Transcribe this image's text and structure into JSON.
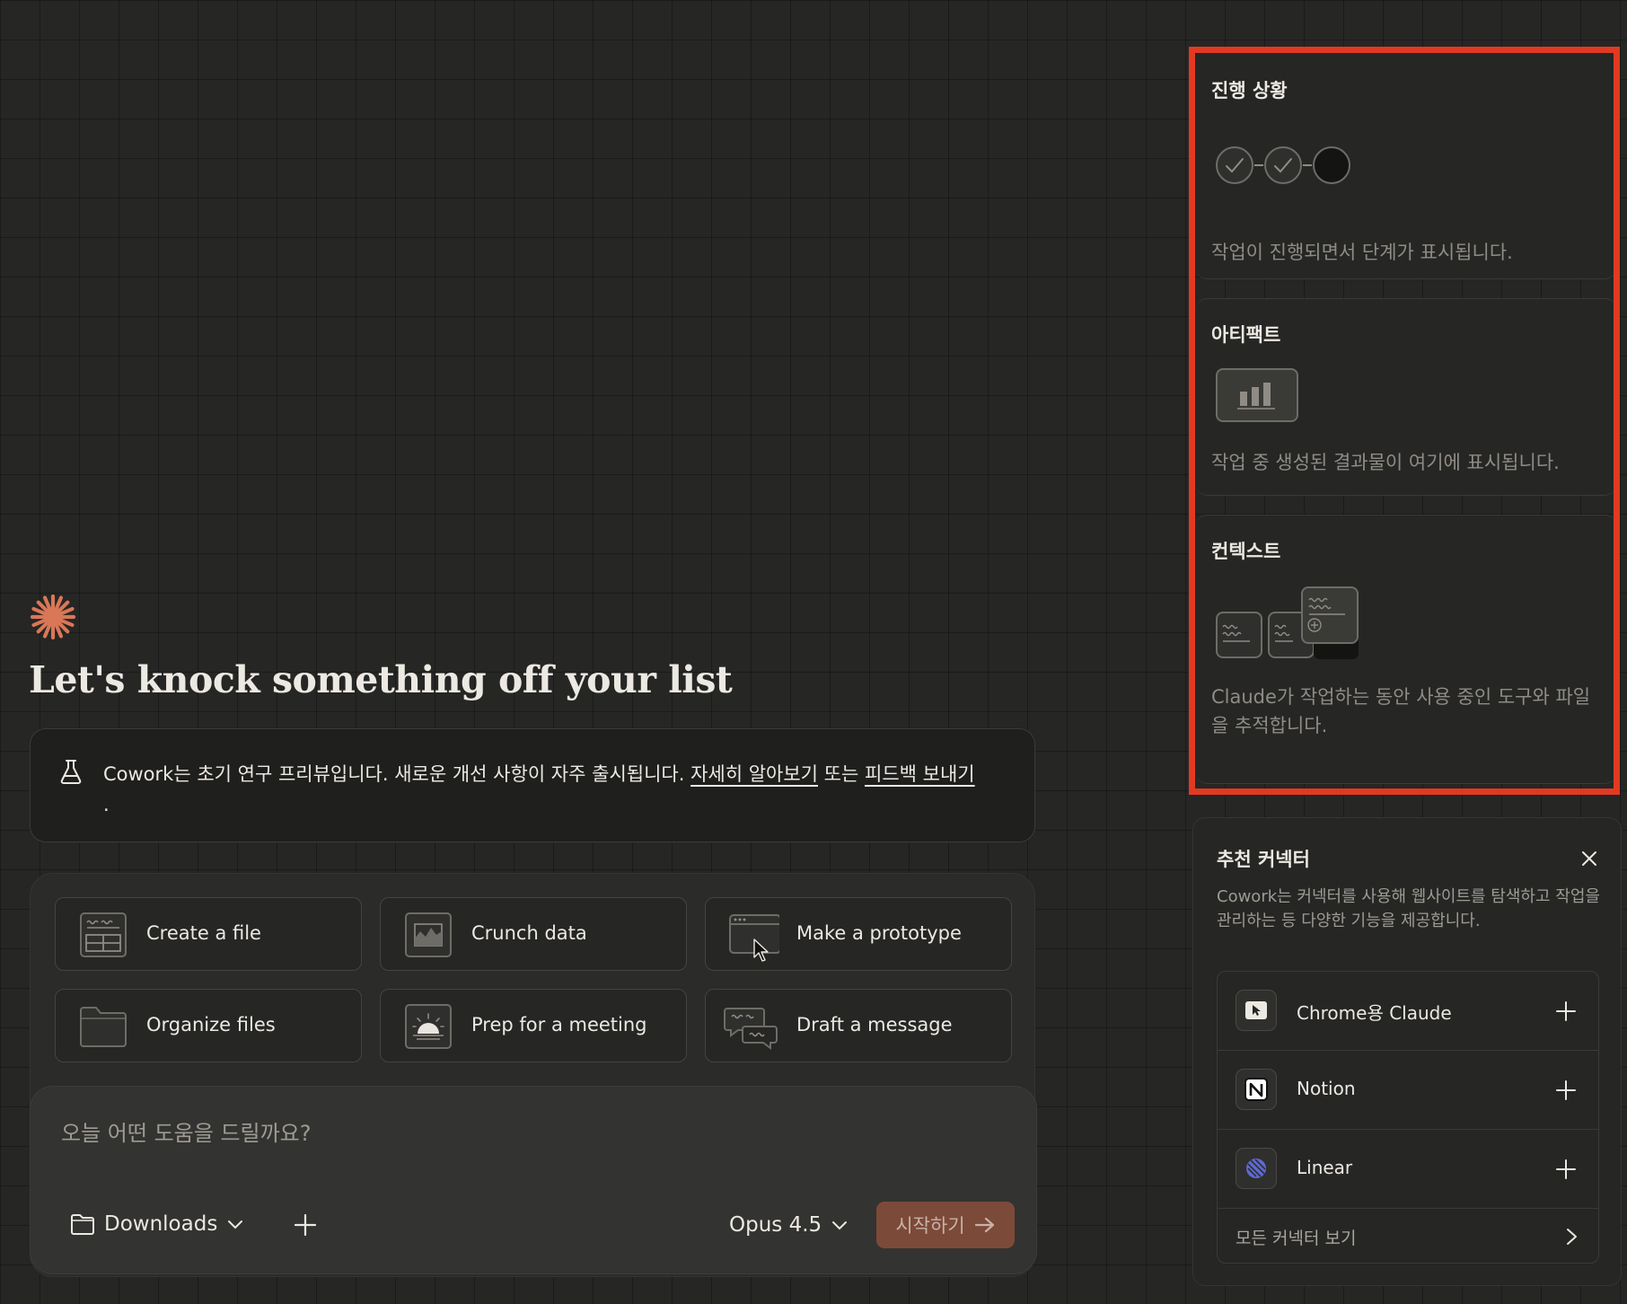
{
  "main": {
    "headline": "Let's knock something off your list",
    "notice": {
      "text": "Cowork는 초기 연구 프리뷰입니다. 새로운 개선 사항이 자주 출시됩니다. ",
      "learn_more": "자세히 알아보기",
      "connector": " 또는 ",
      "feedback": "피드백 보내기",
      "period": "."
    },
    "task_cards": [
      {
        "label": "Create a file",
        "icon": "spreadsheet-icon"
      },
      {
        "label": "Crunch data",
        "icon": "chart-icon"
      },
      {
        "label": "Make a prototype",
        "icon": "browser-window-icon"
      },
      {
        "label": "Organize files",
        "icon": "folder-icon"
      },
      {
        "label": "Prep for a meeting",
        "icon": "sunrise-icon"
      },
      {
        "label": "Draft a message",
        "icon": "chat-bubbles-icon"
      }
    ],
    "composer": {
      "placeholder": "오늘 어떤 도움을 드릴까요?",
      "folder": "Downloads",
      "model": "Opus 4.5",
      "start": "시작하기"
    }
  },
  "side_panel": {
    "progress": {
      "title": "진행 상황",
      "steps": [
        "done",
        "done",
        "pending"
      ],
      "description": "작업이 진행되면서 단계가 표시됩니다."
    },
    "artifacts": {
      "title": "아티팩트",
      "description": "작업 중 생성된 결과물이 여기에 표시됩니다."
    },
    "context": {
      "title": "컨텍스트",
      "description": "Claude가 작업하는 동안 사용 중인 도구와 파일을 추적합니다."
    }
  },
  "recommended_connectors": {
    "title": "추천 커넥터",
    "description": "Cowork는 커넥터를 사용해 웹사이트를 탐색하고 작업을 관리하는 등 다양한 기능을 제공합니다.",
    "items": [
      {
        "name": "Chrome용 Claude",
        "icon": "chrome-claude-icon"
      },
      {
        "name": "Notion",
        "icon": "notion-icon"
      },
      {
        "name": "Linear",
        "icon": "linear-icon"
      }
    ],
    "see_all": "모든 커넥터 보기"
  },
  "colors": {
    "background": "#262625",
    "accent": "#d97757",
    "start_button": "#7c4a39",
    "highlight_frame": "#e23a22",
    "linear": "#5e6ad2"
  }
}
